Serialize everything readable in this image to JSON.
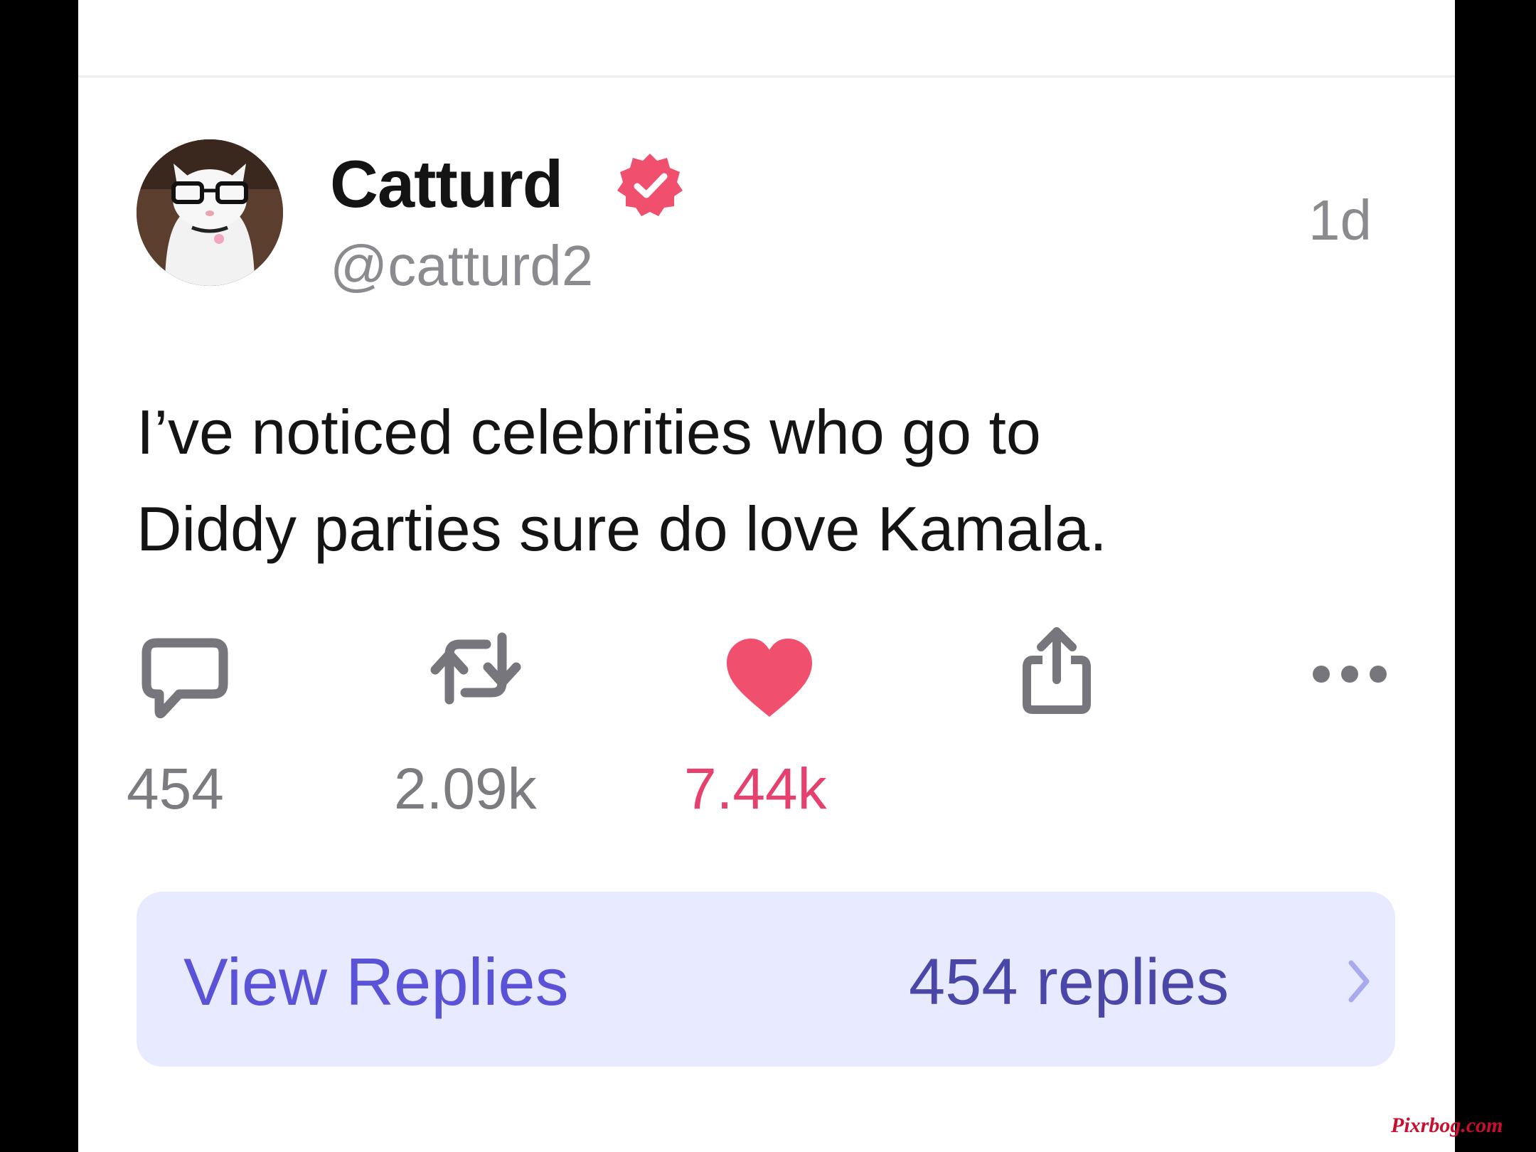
{
  "post": {
    "author": {
      "display_name": "Catturd",
      "handle": "@catturd2",
      "verified": true,
      "avatar_icon": "cat-with-glasses-avatar"
    },
    "timestamp": "1d",
    "text_lines": [
      "I’ve noticed celebrities who go to",
      "Diddy parties sure do love Kamala."
    ],
    "actions": {
      "reply": {
        "icon": "comment-icon",
        "count": "454"
      },
      "retweet": {
        "icon": "repost-icon",
        "count": "2.09k"
      },
      "like": {
        "icon": "heart-icon",
        "count": "7.44k",
        "liked": true
      },
      "share": {
        "icon": "share-icon"
      },
      "more": {
        "icon": "more-icon"
      }
    },
    "replies_panel": {
      "label": "View Replies",
      "count_text": "454 replies"
    }
  },
  "watermark": "Pixrbog.com",
  "colors": {
    "accent_like": "#e5406e",
    "verified_badge": "#f0506e",
    "replies_bg": "#e8eaff",
    "replies_label": "#5a53d8",
    "replies_count": "#4a47a8",
    "muted_text": "#8a8a8f"
  }
}
